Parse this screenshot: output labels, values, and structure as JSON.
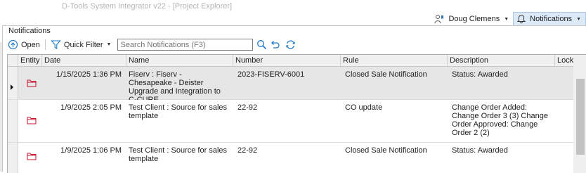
{
  "app": {
    "title": "D-Tools System Integrator v22 - [Project Explorer]"
  },
  "topbar": {
    "user_name": "Doug Clemens",
    "user_caret": "▼",
    "notifications_label": "Notifications",
    "notifications_caret": "▼"
  },
  "panel": {
    "title": "Notifications"
  },
  "toolbar": {
    "open_label": "Open",
    "quick_filter_label": "Quick Filter",
    "quick_filter_caret": "▼",
    "search_placeholder": "Search Notifications (F3)"
  },
  "grid": {
    "columns": [
      {
        "label": "Entity"
      },
      {
        "label": "Date"
      },
      {
        "label": "Name"
      },
      {
        "label": "Number"
      },
      {
        "label": "Rule"
      },
      {
        "label": "Description"
      },
      {
        "label": "Lock"
      }
    ],
    "rows": [
      {
        "date": "1/15/2025 1:36 PM",
        "name": "Fiserv : Fiserv - Chesapeake - Deister Upgrade and Integration to C-CURE",
        "number": "2023-FISERV-6001",
        "rule": "Closed Sale Notification",
        "description": "Status: Awarded",
        "selected": true
      },
      {
        "date": "1/9/2025 2:05 PM",
        "name": "Test Client : Source for sales template",
        "number": "22-92",
        "rule": "CO update",
        "description": "Change Order Added: Change Order 3 (3) Change Order Approved: Change Order 2 (2)",
        "selected": false
      },
      {
        "date": "1/9/2025 1:06 PM",
        "name": "Test Client : Source for sales template",
        "number": "22-92",
        "rule": "Closed Sale Notification",
        "description": "Status: Awarded",
        "selected": false
      }
    ]
  },
  "colors": {
    "folder": "#c8102e",
    "accent": "#1f78c8",
    "selected_row": "#e6e6e6"
  }
}
